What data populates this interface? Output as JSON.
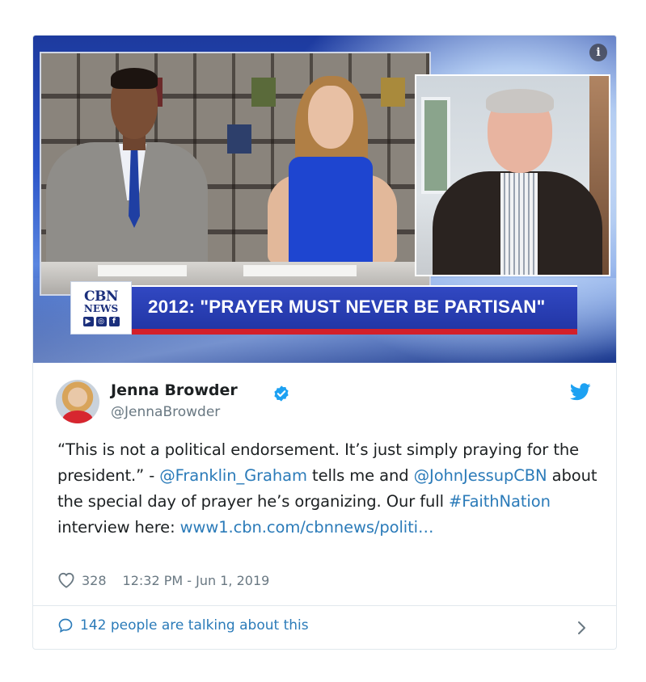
{
  "media": {
    "logo_line1": "CBN",
    "logo_line2": "NEWS",
    "logo_icons": [
      "youtube-icon",
      "instagram-icon",
      "facebook-icon"
    ],
    "headline": "2012: \"PRAYER MUST NEVER BE PARTISAN\"",
    "info_glyph": "i"
  },
  "author": {
    "name": "Jenna Browder",
    "handle": "@JennaBrowder",
    "verified": true
  },
  "tweet": {
    "part1": "“This is not a political endorsement. It’s just simply praying for the president.” - ",
    "mention1": "@Franklin_Graham",
    "part2": " tells me and ",
    "mention2": "@JohnJessupCBN",
    "part3": " about the special day of prayer he’s organizing. Our full ",
    "hashtag": "#FaithNation",
    "part4": " interview here: ",
    "url": "www1.cbn.com/cbnnews/politi…"
  },
  "meta": {
    "likes": "328",
    "timestamp": "12:32 PM - Jun 1, 2019"
  },
  "footer": {
    "talking": "142 people are talking about this"
  },
  "colors": {
    "link": "#2b7bb9",
    "twitter_blue": "#1da1f2",
    "muted": "#697882",
    "banner_blue": "#2236a6",
    "banner_red": "#d3202a"
  }
}
